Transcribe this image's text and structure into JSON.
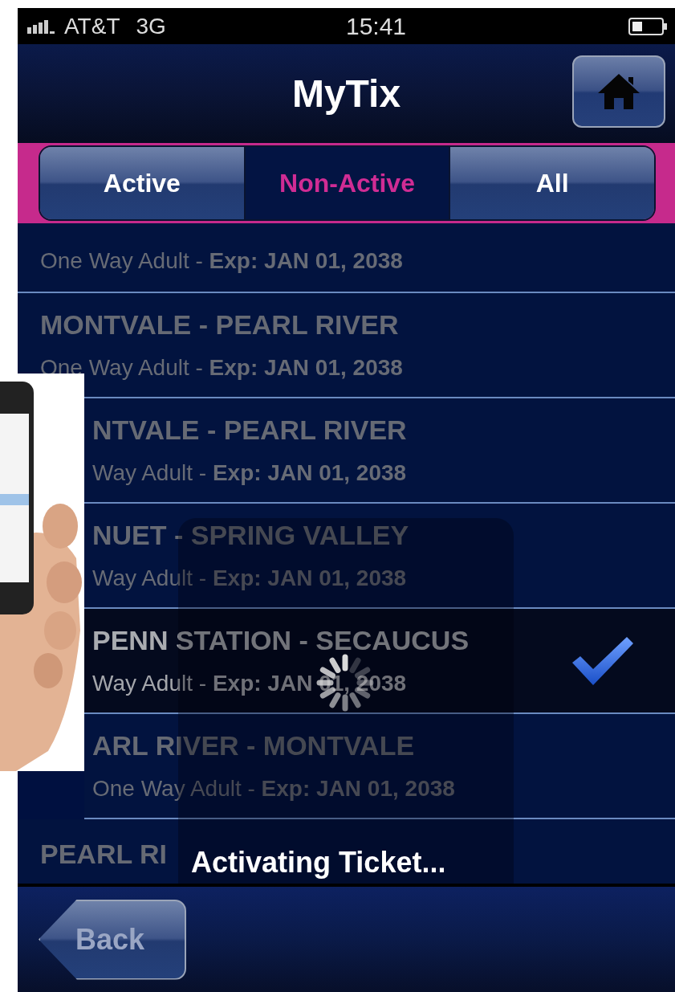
{
  "status_bar": {
    "carrier": "AT&T",
    "network": "3G",
    "time": "15:41"
  },
  "nav_bar": {
    "title": "MyTix"
  },
  "segments": [
    {
      "label": "Active",
      "selected": false
    },
    {
      "label": "Non-Active",
      "selected": true
    },
    {
      "label": "All",
      "selected": false
    }
  ],
  "tickets": [
    {
      "detail": "One Way Adult - **Exp: JAN 01, 2038**",
      "selected": false,
      "covered": false
    },
    {
      "route": "MONTVALE - PEARL RIVER",
      "detail": "One Way Adult - **Exp: JAN 01, 2038**",
      "selected": false,
      "covered": false
    },
    {
      "route": "NTVALE - PEARL RIVER",
      "detail": "Way Adult - **Exp: JAN 01, 2038**",
      "selected": false,
      "covered": true
    },
    {
      "route": "NUET - SPRING VALLEY",
      "detail": "Way Adult - **Exp: JAN 01, 2038**",
      "selected": false,
      "covered": true
    },
    {
      "route": "PENN STATION - SECAUCUS",
      "detail": "Way Adult - **Exp: JAN 01, 2038**",
      "selected": true,
      "covered": true
    },
    {
      "route": "ARL RIVER - MONTVALE",
      "detail": "One Way Adult - **Exp: JAN 01, 2038**",
      "selected": false,
      "covered": true
    },
    {
      "route": "PEARL RI",
      "selected": false,
      "covered": false
    }
  ],
  "hud": {
    "message": "Activating Ticket..."
  },
  "toolbar": {
    "back": "Back"
  }
}
